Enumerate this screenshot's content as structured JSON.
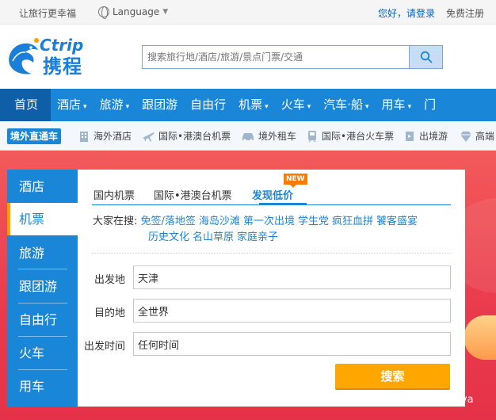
{
  "topbar": {
    "slogan": "让旅行更幸福",
    "language": "Language",
    "login": "您好，请登录",
    "register": "免费注册"
  },
  "header": {
    "logo_en": "Ctrip",
    "logo_cn": "携程",
    "search_placeholder": "搜索旅行地/酒店/旅游/景点门票/交通"
  },
  "mainnav": {
    "items": [
      "首页",
      "酒店",
      "旅游",
      "跟团游",
      "自由行",
      "机票",
      "火车",
      "汽车·船",
      "用车",
      "门"
    ],
    "dropdown_marker": "▾"
  },
  "subnav": {
    "tag": "境外直通车",
    "items": [
      "海外酒店",
      "国际•港澳台机票",
      "境外租车",
      "国际•港台火车票",
      "出境游",
      "高端"
    ]
  },
  "booking": {
    "side_items": [
      "酒店",
      "机票",
      "旅游",
      "跟团游",
      "自由行",
      "火车",
      "用车"
    ],
    "active_side": "机票",
    "tabs": [
      "国内机票",
      "国际•港澳台机票",
      "发现低价"
    ],
    "active_tab": "发现低价",
    "new_badge": "NEW",
    "hot_label": "大家在搜:",
    "hot_links": [
      "免签/落地签",
      "海岛沙滩",
      "第一次出境",
      "学生党",
      "疯狂血拼",
      "饕客盛宴",
      "历史文化",
      "名山草原",
      "家庭亲子"
    ],
    "fields": [
      {
        "label": "出发地",
        "value": "天津"
      },
      {
        "label": "目的地",
        "value": "全世界"
      },
      {
        "label": "出发时间",
        "value": "任何时间"
      }
    ],
    "search_button": "搜索"
  },
  "watermark": "Cinova",
  "colors": {
    "brand_blue": "#1a86d8",
    "nav_active": "#0e5ea8",
    "search_button": "#ffa600",
    "hero_red": "#e93a4c"
  }
}
